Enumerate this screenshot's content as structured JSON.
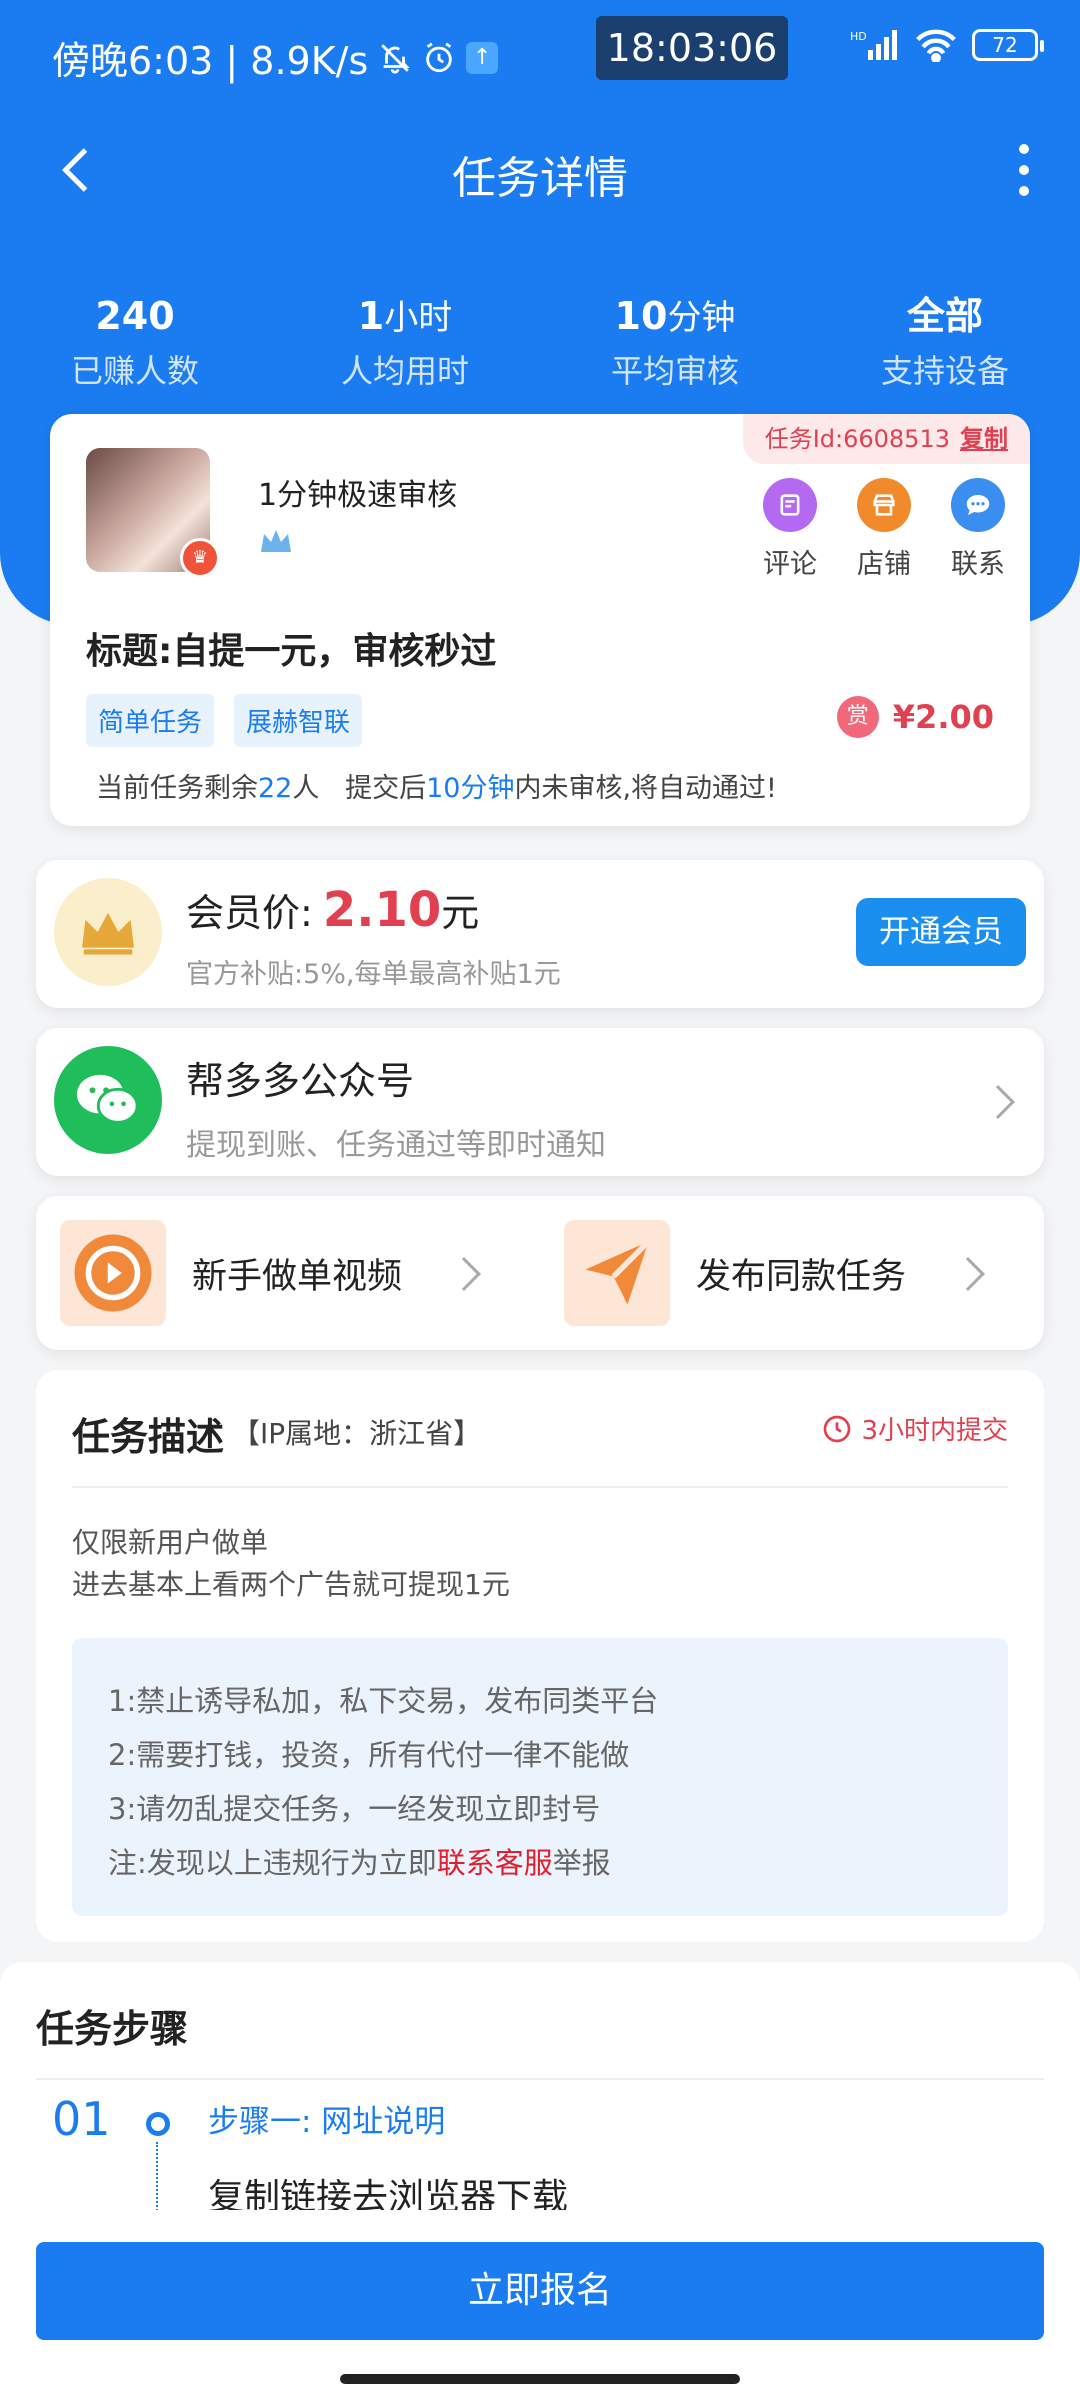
{
  "status_bar": {
    "left_text": "傍晚6:03 | 8.9K/s",
    "clock": "18:03:06",
    "battery": "72"
  },
  "nav": {
    "title": "任务详情"
  },
  "stats": [
    {
      "value": "240",
      "unit": "",
      "label": "已赚人数"
    },
    {
      "value": "1",
      "unit": "小时",
      "label": "人均用时"
    },
    {
      "value": "10",
      "unit": "分钟",
      "label": "平均审核"
    },
    {
      "value": "全部",
      "unit": "",
      "label": "支持设备"
    }
  ],
  "task": {
    "id_label": "任务Id:6608513",
    "copy_label": "复制",
    "shop_name": "1分钟极速审核",
    "actions": [
      {
        "label": "评论",
        "color": "#b36af0"
      },
      {
        "label": "店铺",
        "color": "#f08a2a"
      },
      {
        "label": "联系",
        "color": "#3a8ef0"
      }
    ],
    "title": "标题:自提一元，审核秒过",
    "tags": [
      "简单任务",
      "展赫智联"
    ],
    "reward_badge": "赏",
    "reward": "¥2.00",
    "remain_prefix": "当前任务剩余",
    "remain_count": "22",
    "remain_mid": "人   提交后",
    "remain_time": "10分钟",
    "remain_suffix": "内未审核,将自动通过!"
  },
  "vip": {
    "label": "会员价:",
    "price": "2.10",
    "unit": "元",
    "subtitle": "官方补贴:5%,每单最高补贴1元",
    "button": "开通会员"
  },
  "wechat": {
    "title": "帮多多公众号",
    "subtitle": "提现到账、任务通过等即时通知"
  },
  "quick_links": [
    {
      "label": "新手做单视频"
    },
    {
      "label": "发布同款任务"
    }
  ],
  "description": {
    "heading": "任务描述",
    "ip": "【IP属地：浙江省】",
    "deadline": "3小时内提交",
    "lines": [
      "仅限新用户做单",
      "进去基本上看两个广告就可提现1元"
    ],
    "rules": [
      "1:禁止诱导私加，私下交易，发布同类平台",
      "2:需要打钱，投资，所有代付一律不能做",
      "3:请勿乱提交任务，一经发现立即封号"
    ],
    "note_prefix": "注:发现以上违规行为立即",
    "note_link": "联系客服",
    "note_suffix": "举报"
  },
  "steps": {
    "heading": "任务步骤",
    "items": [
      {
        "number": "01",
        "title": "步骤一: 网址说明",
        "text": "复制链接去浏览器下载"
      }
    ]
  },
  "bottom": {
    "signup": "立即报名"
  }
}
